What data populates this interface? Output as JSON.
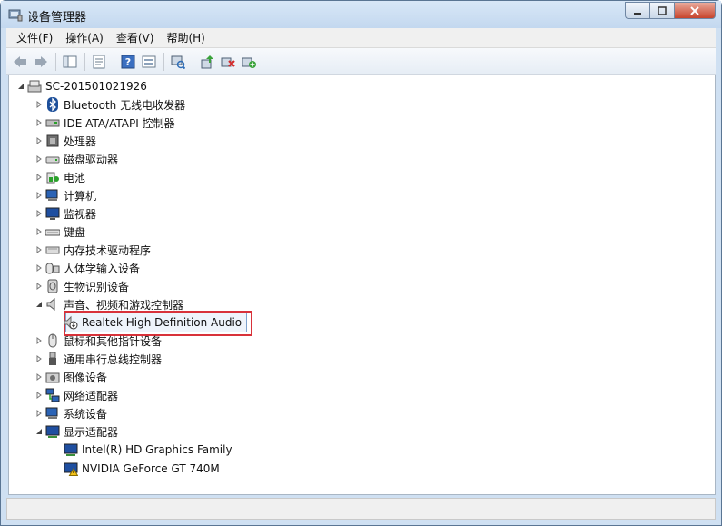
{
  "window": {
    "title": "设备管理器",
    "close_color": "#c7442c"
  },
  "menu": [
    "文件(F)",
    "操作(A)",
    "查看(V)",
    "帮助(H)"
  ],
  "toolbar_icons": [
    "back-icon",
    "forward-icon",
    "console-tree-icon",
    "properties-icon",
    "help-icon",
    "view-icon",
    "scan-hardware-icon",
    "update-driver-icon",
    "uninstall-icon",
    "enable-device-icon"
  ],
  "tree": {
    "root": "SC-201501021926",
    "categories": [
      "Bluetooth 无线电收发器",
      "IDE ATA/ATAPI 控制器",
      "处理器",
      "磁盘驱动器",
      "电池",
      "计算机",
      "监视器",
      "键盘",
      "内存技术驱动程序",
      "人体学输入设备",
      "生物识别设备",
      "声音、视频和游戏控制器",
      "鼠标和其他指针设备",
      "通用串行总线控制器",
      "图像设备",
      "网络适配器",
      "系统设备",
      "显示适配器"
    ],
    "sound_children": [
      "Realtek High Definition Audio"
    ],
    "display_children": [
      "Intel(R) HD Graphics Family",
      "NVIDIA GeForce GT 740M"
    ]
  }
}
